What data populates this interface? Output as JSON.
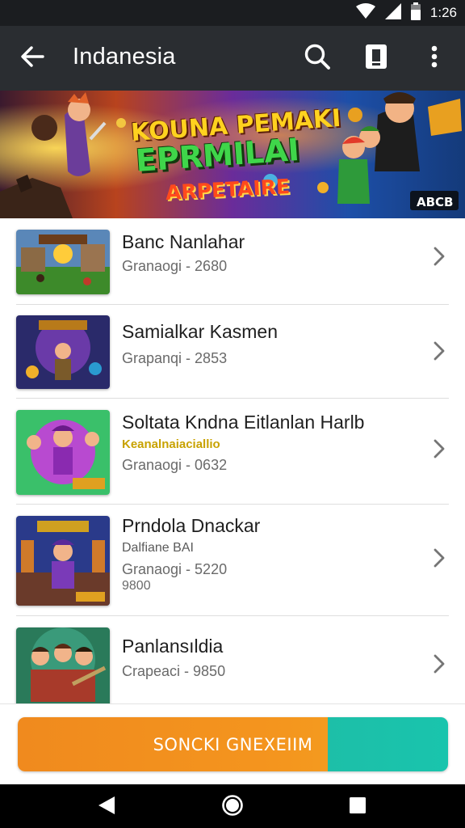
{
  "status_bar": {
    "time": "1:26",
    "icons": [
      "wifi-icon",
      "signal-icon",
      "battery-icon"
    ]
  },
  "app_bar": {
    "title": "Indanesia",
    "icons": [
      "back-arrow-icon",
      "search-icon",
      "device-icon",
      "more-vert-icon"
    ]
  },
  "banner": {
    "title_line1": "KOUNA PEMAKI",
    "title_line2": "EPRMILAI",
    "subtitle": "ARPETAIRE",
    "tag": "ABCB"
  },
  "games": [
    {
      "title": "Banc Nanlahar",
      "tagline": "",
      "detail": "",
      "meta": "Granaogi - 2680",
      "extra": ""
    },
    {
      "title": "Samialkar Kasmen",
      "tagline": "",
      "detail": "",
      "meta": "Grapanqi - 2853",
      "extra": ""
    },
    {
      "title": "Soltata Kndna Eitlanlan Harlb",
      "tagline": "Keanalnaiaciallio",
      "detail": "",
      "meta": "Granaogi - 0632",
      "extra": ""
    },
    {
      "title": "Prndola Dnackar",
      "tagline": "",
      "detail": "Dalfiane BAI",
      "meta": "Granaogi - 5220",
      "extra": "9800"
    },
    {
      "title": "Panlansıldia",
      "tagline": "",
      "detail": "",
      "meta": "Crapeaci - 9850",
      "extra": ""
    }
  ],
  "cta": {
    "label": "SONCKI GNEXEIIM"
  },
  "colors": {
    "status_bar": "#1b1d20",
    "app_bar": "#2a2d31",
    "cta_orange": "#f08a1e",
    "cta_teal": "#1dbfa8",
    "chevron": "#757575"
  },
  "nav_bar": {
    "icons": [
      "nav-back-icon",
      "nav-home-icon",
      "nav-recents-icon"
    ]
  }
}
